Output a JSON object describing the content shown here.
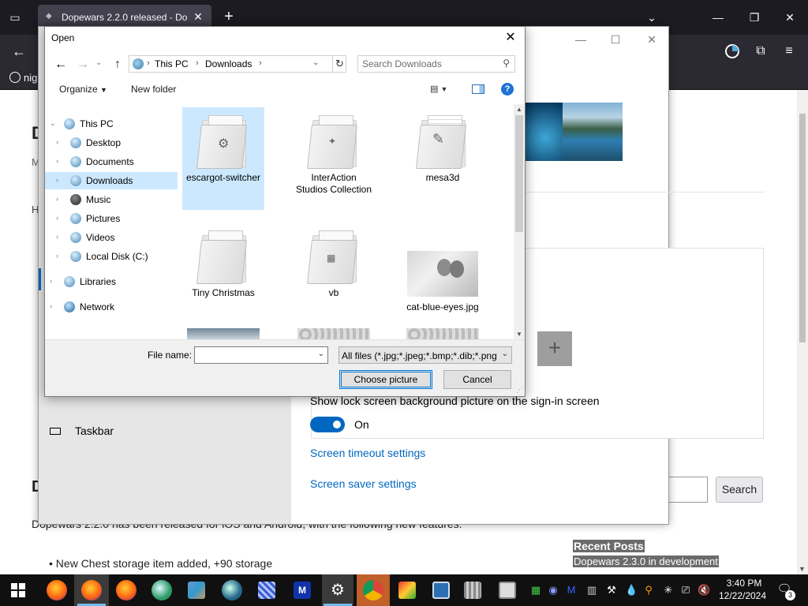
{
  "browser": {
    "tab_title": "Dopewars 2.2.0 released - Dope",
    "bookmark_label": "nig"
  },
  "webpage": {
    "intro_text": "Dopewars 2.2.0 has been released for iOS and Android, with the following new features:",
    "bullet_1": "New Chest storage item added, +90 storage",
    "search_button": "Search",
    "recent_posts_title": "Recent Posts",
    "recent_post_1": "Dopewars 2.3.0 in development",
    "frag_D1": "D",
    "frag_M": "M",
    "frag_H": "H",
    "frag_D2": "D"
  },
  "settings": {
    "lock_screen_label": "Show lock screen background picture on the sign-in screen",
    "toggle_state": "On",
    "link_timeout": "Screen timeout settings",
    "link_saver": "Screen saver settings",
    "sidebar_taskbar": "Taskbar"
  },
  "dialog": {
    "title": "Open",
    "breadcrumb": [
      "This PC",
      "Downloads"
    ],
    "search_placeholder": "Search Downloads",
    "toolbar": {
      "organize": "Organize",
      "new_folder": "New folder"
    },
    "nav": [
      {
        "label": "This PC",
        "level": 0
      },
      {
        "label": "Desktop",
        "level": 1
      },
      {
        "label": "Documents",
        "level": 1
      },
      {
        "label": "Downloads",
        "level": 1,
        "selected": true
      },
      {
        "label": "Music",
        "level": 1
      },
      {
        "label": "Pictures",
        "level": 1
      },
      {
        "label": "Videos",
        "level": 1
      },
      {
        "label": "Local Disk (C:)",
        "level": 1
      },
      {
        "label": "Libraries",
        "level": 0
      },
      {
        "label": "Network",
        "level": 0
      }
    ],
    "files": [
      {
        "name": "escargot-switcher",
        "kind": "folder",
        "selected": true
      },
      {
        "name": "InterAction Studios Collection",
        "kind": "folder"
      },
      {
        "name": "mesa3d",
        "kind": "folder"
      },
      {
        "name": "Tiny Christmas",
        "kind": "folder"
      },
      {
        "name": "vb",
        "kind": "folder"
      },
      {
        "name": "cat-blue-eyes.jpg",
        "kind": "image"
      }
    ],
    "file_name_label": "File name:",
    "file_name_value": "",
    "file_type_filter": "All files (*.jpg;*.jpeg;*.bmp;*.dib;*.png",
    "choose_button": "Choose picture",
    "cancel_button": "Cancel"
  },
  "taskbar": {
    "time": "3:40 PM",
    "date": "12/22/2024",
    "notification_count": "3"
  }
}
